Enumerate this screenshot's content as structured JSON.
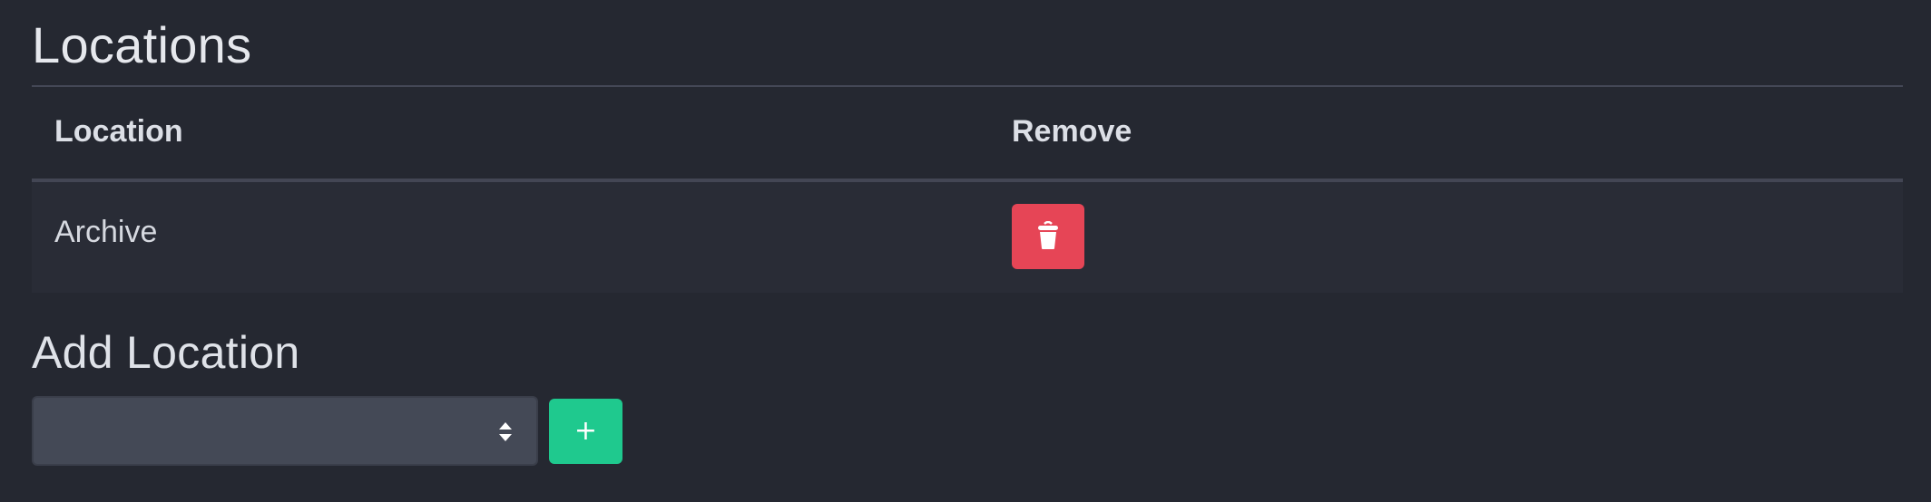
{
  "locations_section": {
    "title": "Locations",
    "table": {
      "headers": {
        "location": "Location",
        "remove": "Remove"
      },
      "rows": [
        {
          "location": "Archive",
          "remove_icon": "trash-icon"
        }
      ]
    }
  },
  "add_section": {
    "title": "Add Location",
    "select": {
      "selected_value": "",
      "icon": "select-arrows-icon"
    },
    "add_button": {
      "label": "+"
    }
  },
  "colors": {
    "background": "#252831",
    "remove_button": "#e64556",
    "add_button": "#1fc98e",
    "select_background": "#444956"
  }
}
